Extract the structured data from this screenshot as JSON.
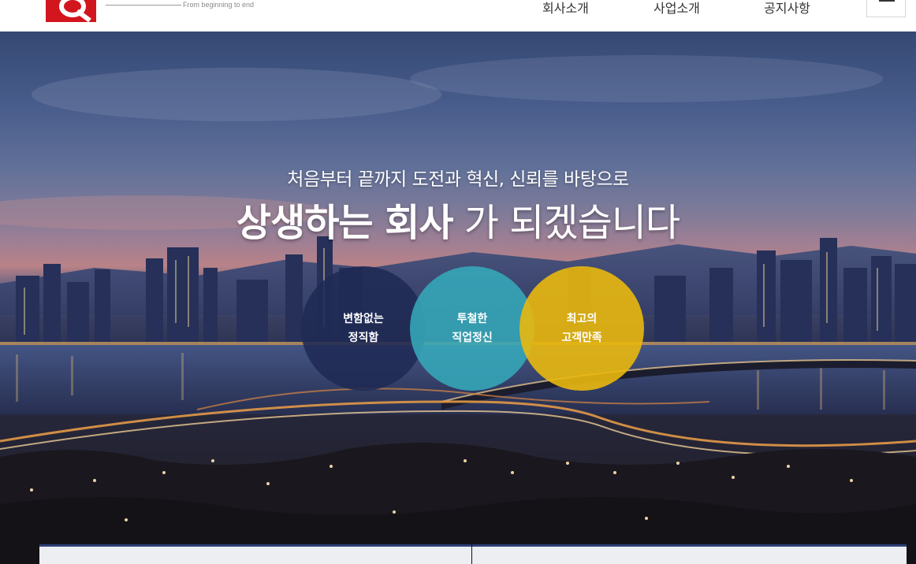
{
  "header": {
    "tagline": "From beginning to end",
    "nav": [
      {
        "label": "회사소개"
      },
      {
        "label": "사업소개"
      },
      {
        "label": "공지사항"
      }
    ],
    "menu_icon": "hamburger-icon"
  },
  "hero": {
    "subtitle": "처음부터 끝까지 도전과 혁신, 신뢰를 바탕으로",
    "headline_strong": "상생하는 회사",
    "headline_rest": " 가 되겠습니다",
    "values": [
      {
        "line1": "변함없는",
        "line2": "정직함",
        "color": "#1f2a54"
      },
      {
        "line1": "투철한",
        "line2": "직업정신",
        "color": "#35a8b9"
      },
      {
        "line1": "최고의",
        "line2": "고객만족",
        "color": "#e9b80e"
      }
    ]
  },
  "colors": {
    "brand_red": "#d2161e",
    "panel_border": "#2f3f78"
  }
}
